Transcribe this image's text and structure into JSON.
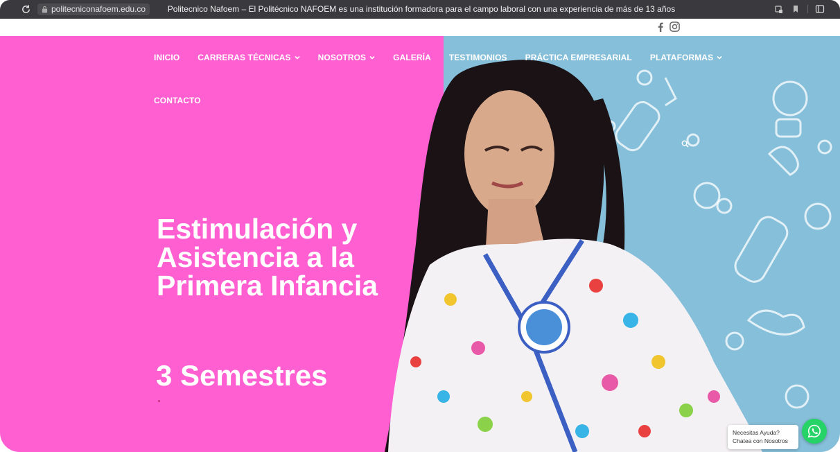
{
  "browser": {
    "url": "politecniconafoem.edu.co",
    "title": "Politecnico Nafoem – El Politécnico NAFOEM es una institución formadora para el campo laboral con una experiencia de más de 13 años"
  },
  "social": {
    "icons": [
      "facebook-icon",
      "instagram-icon"
    ]
  },
  "nav": {
    "items": [
      {
        "label": "INICIO",
        "dropdown": false
      },
      {
        "label": "CARRERAS TÉCNICAS",
        "dropdown": true
      },
      {
        "label": "NOSOTROS",
        "dropdown": true
      },
      {
        "label": "GALERÍA",
        "dropdown": false
      },
      {
        "label": "TESTIMONIOS",
        "dropdown": false
      },
      {
        "label": "PRÁCTICA EMPRESARIAL",
        "dropdown": false
      },
      {
        "label": "PLATAFORMAS",
        "dropdown": true
      },
      {
        "label": "CONTACTO",
        "dropdown": false
      }
    ]
  },
  "hero": {
    "title_lines": [
      "Estimulación y",
      "Asistencia a la",
      "Primera Infancia"
    ],
    "subtitle": "3 Semestres"
  },
  "chat": {
    "text": "Necesitas Ayuda? Chatea con Nosotros"
  },
  "colors": {
    "pink": "#ff5fd0",
    "blue": "#86bfd9",
    "whatsapp": "#25d366"
  }
}
